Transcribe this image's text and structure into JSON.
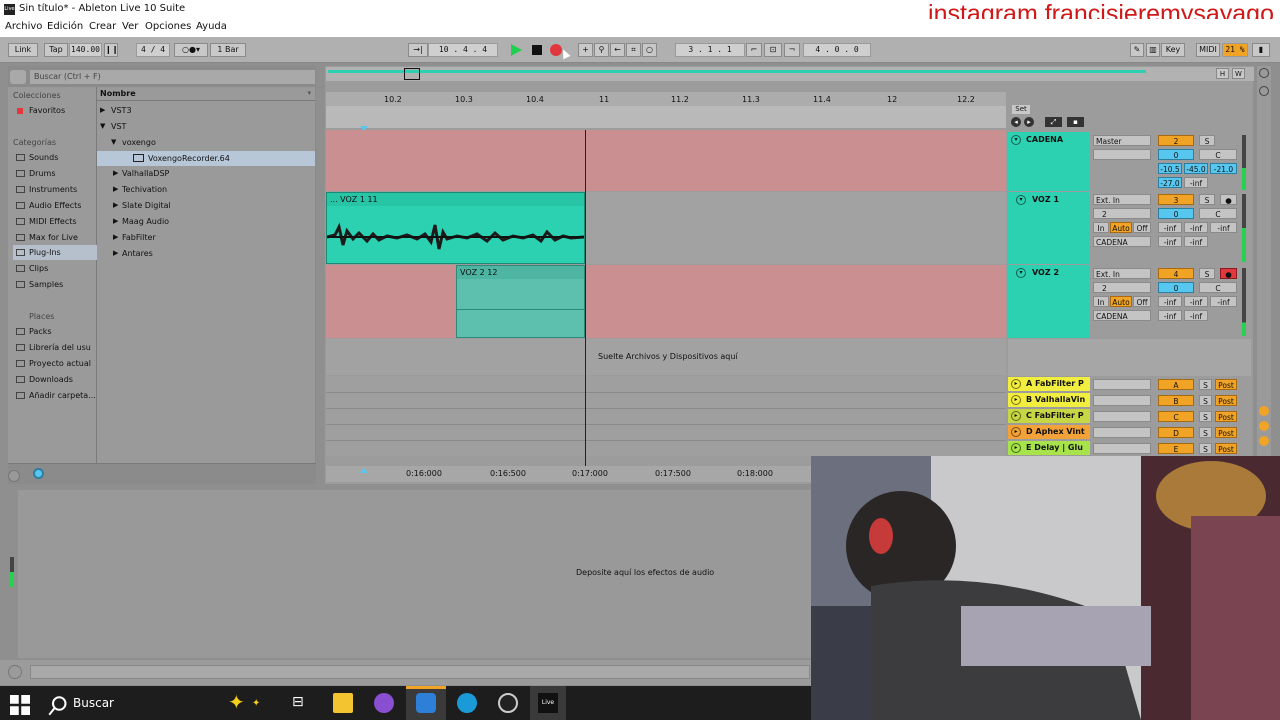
{
  "window": {
    "title": "Sin título* - Ableton Live 10 Suite",
    "logo": "Live"
  },
  "watermark": "instagram francisjeremysayago",
  "menu": [
    "Archivo",
    "Edición",
    "Crear",
    "Ver",
    "Opciones",
    "Ayuda"
  ],
  "transport": {
    "link": "Link",
    "tap": "Tap",
    "tempo": "140.00",
    "signature": "4 / 4",
    "quantize": "1 Bar",
    "position": "10 .  4 .  4",
    "loop_start": "3 .  1 .  1",
    "loop_length": "4 .  0 .  0",
    "key": "Key",
    "midi": "MIDI",
    "cpu": "21 %"
  },
  "browser": {
    "search_placeholder": "Buscar (Ctrl + F)",
    "collections_header": "Colecciones",
    "favorites": "Favoritos",
    "categories_header": "Categorías",
    "categories": [
      "Sounds",
      "Drums",
      "Instruments",
      "Audio Effects",
      "MIDI Effects",
      "Max for Live",
      "Plug-Ins",
      "Clips",
      "Samples"
    ],
    "selected_category": "Plug-Ins",
    "places_header": "Places",
    "places": [
      "Packs",
      "Librería del usu",
      "Proyecto actual",
      "Downloads",
      "Añadir carpeta..."
    ],
    "list_header": "Nombre",
    "list_items": [
      "VST3",
      "VST",
      "voxengo",
      "VoxengoRecorder.64",
      "ValhallaDSP",
      "Techivation",
      "Slate Digital",
      "Maag Audio",
      "FabFilter",
      "Antares"
    ]
  },
  "arrangement": {
    "set_label": "Set",
    "bar_ticks": [
      "10.2",
      "10.3",
      "10.4",
      "11",
      "11.2",
      "11.3",
      "11.4",
      "12",
      "12.2"
    ],
    "time_ticks": [
      "0:16:000",
      "0:16:500",
      "0:17:000",
      "0:17:500",
      "0:18:000"
    ],
    "drop_hint": "Suelte Archivos y Dispositivos aquí",
    "clip_voz1": "... VOZ 1 11",
    "clip_voz2": "VOZ 2 12",
    "overview_buttons": [
      "H",
      "W"
    ]
  },
  "tracks": [
    {
      "name": "CADENA",
      "routing": "Master",
      "number": "2",
      "vol": "0",
      "pan": "C",
      "vals": [
        "-10.5",
        "-45.0",
        "-21.0",
        "-27.0",
        "-inf"
      ],
      "color": "#2bd1b1"
    },
    {
      "name": "VOZ 1",
      "input": "Ext. In",
      "channel": "2",
      "output": "CADENA",
      "number": "3",
      "vol": "0",
      "pan": "C",
      "monitor": [
        "In",
        "Auto",
        "Off"
      ],
      "vals": [
        "-inf",
        "-inf",
        "-inf",
        "-inf",
        "-inf"
      ],
      "color": "#2bd1b1"
    },
    {
      "name": "VOZ 2",
      "input": "Ext. In",
      "channel": "2",
      "output": "CADENA",
      "number": "4",
      "vol": "0",
      "pan": "C",
      "monitor": [
        "In",
        "Auto",
        "Off"
      ],
      "vals": [
        "-inf",
        "-inf",
        "-inf",
        "-inf",
        "-inf"
      ],
      "color": "#2bd1b1"
    }
  ],
  "returns": [
    {
      "name": "A FabFilter P",
      "letter": "A",
      "post": "Post"
    },
    {
      "name": "B ValhallaVin",
      "letter": "B",
      "post": "Post"
    },
    {
      "name": "C FabFilter P",
      "letter": "C",
      "post": "Post"
    },
    {
      "name": "D Aphex Vint",
      "letter": "D",
      "post": "Post"
    },
    {
      "name": "E Delay | Glu",
      "letter": "E",
      "post": "Post"
    }
  ],
  "device_hint": "Deposite aquí los efectos de audio",
  "taskbar": {
    "search": "Buscar"
  },
  "colors": {
    "accent": "#f1a326",
    "clip_teal": "#2bd1b1",
    "track_pink": "#d49a9c",
    "record": "#e2373d",
    "play": "#1fd04f"
  }
}
